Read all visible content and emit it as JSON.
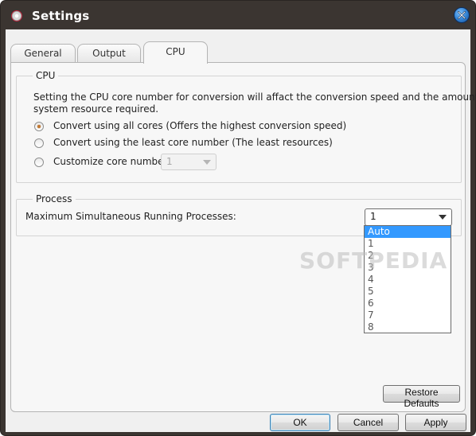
{
  "window": {
    "title": "Settings"
  },
  "tabs": [
    {
      "label": "General",
      "active": false
    },
    {
      "label": "Output",
      "active": false
    },
    {
      "label": "CPU",
      "active": true
    }
  ],
  "cpu_group": {
    "legend": "CPU",
    "description_line1": "Setting the CPU core number for conversion will affact the conversion  speed and the amount of",
    "description_line2": "system resource required.",
    "options": [
      {
        "label": "Convert using all cores (Offers the highest conversion speed)",
        "checked": true
      },
      {
        "label": "Convert using the least core number (The least resources)",
        "checked": false
      },
      {
        "label": "Customize core number",
        "checked": false
      }
    ],
    "core_number_value": "1"
  },
  "process_group": {
    "legend": "Process",
    "label": "Maximum Simultaneous Running Processes:",
    "selected_value": "1",
    "dropdown_options": [
      "Auto",
      "1",
      "2",
      "3",
      "4",
      "5",
      "6",
      "7",
      "8"
    ],
    "highlighted_option": "Auto"
  },
  "watermark": "SOFTPEDIA",
  "buttons": {
    "restore_defaults": "Restore Defaults",
    "ok": "OK",
    "cancel": "Cancel",
    "apply": "Apply"
  },
  "colors": {
    "title_bar": "#3b3531",
    "highlight": "#3399ff",
    "radio_dot": "#c27a34"
  }
}
